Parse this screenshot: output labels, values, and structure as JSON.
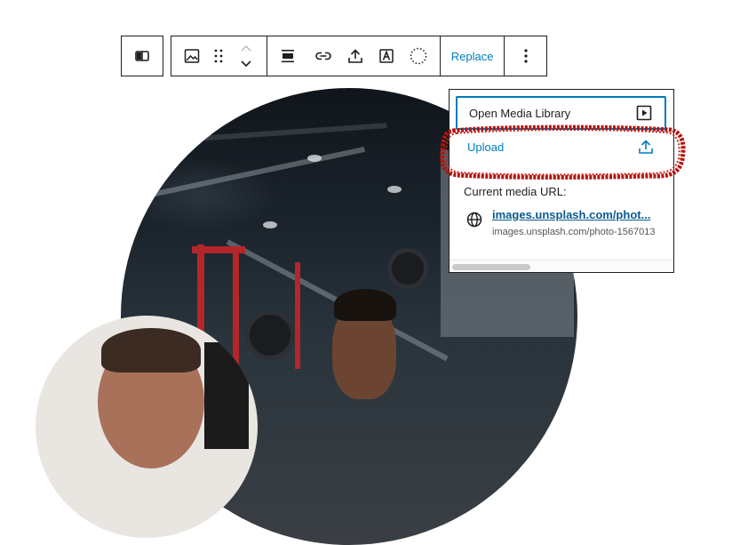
{
  "toolbar": {
    "buttons": [
      {
        "name": "block-type",
        "icon": "columns-icon"
      },
      {
        "name": "image",
        "icon": "image-icon"
      },
      {
        "name": "drag",
        "icon": "drag-handle-icon"
      },
      {
        "name": "move-up",
        "icon": "chevron-up-icon"
      },
      {
        "name": "move-down",
        "icon": "chevron-down-icon"
      },
      {
        "name": "align",
        "icon": "align-icon"
      },
      {
        "name": "link",
        "icon": "link-icon"
      },
      {
        "name": "upload",
        "icon": "upload-icon"
      },
      {
        "name": "text-overlay",
        "icon": "text-icon"
      },
      {
        "name": "duotone",
        "icon": "circle-dotted-icon"
      },
      {
        "name": "options",
        "icon": "more-vertical-icon"
      }
    ],
    "replace_label": "Replace"
  },
  "media_menu": {
    "open_library_label": "Open Media Library",
    "upload_label": "Upload",
    "current_url_label": "Current media URL:",
    "current_url_link": "images.unsplash.com/phot...",
    "current_url_full": "images.unsplash.com/photo-1567013"
  },
  "colors": {
    "accent": "#007cba",
    "link": "#0a5a91",
    "highlight": "#b3140f",
    "border": "#1e1e1e"
  }
}
